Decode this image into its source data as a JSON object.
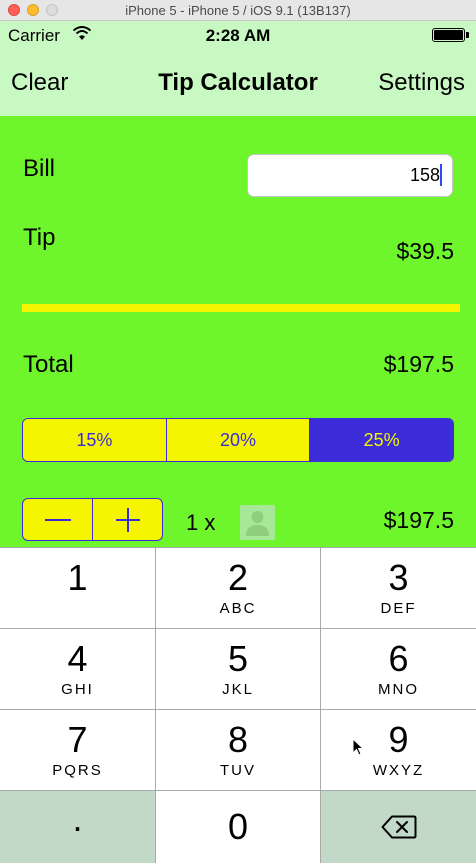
{
  "window": {
    "title": "iPhone 5 - iPhone 5 / iOS 9.1 (13B137)"
  },
  "status_bar": {
    "carrier": "Carrier",
    "time": "2:28 AM"
  },
  "nav": {
    "left": "Clear",
    "title": "Tip Calculator",
    "right": "Settings"
  },
  "bill": {
    "label": "Bill",
    "value": "158"
  },
  "tip": {
    "label": "Tip",
    "value": "$39.5"
  },
  "total": {
    "label": "Total",
    "value": "$197.5"
  },
  "tip_options": [
    {
      "label": "15%",
      "selected": false
    },
    {
      "label": "20%",
      "selected": false
    },
    {
      "label": "25%",
      "selected": true
    }
  ],
  "split": {
    "count_text": "1 x",
    "per_person": "$197.5"
  },
  "keypad": {
    "keys": [
      {
        "num": "1",
        "letters": ""
      },
      {
        "num": "2",
        "letters": "ABC"
      },
      {
        "num": "3",
        "letters": "DEF"
      },
      {
        "num": "4",
        "letters": "GHI"
      },
      {
        "num": "5",
        "letters": "JKL"
      },
      {
        "num": "6",
        "letters": "MNO"
      },
      {
        "num": "7",
        "letters": "PQRS"
      },
      {
        "num": "8",
        "letters": "TUV"
      },
      {
        "num": "9",
        "letters": "WXYZ"
      },
      {
        "num": ".",
        "letters": ""
      },
      {
        "num": "0",
        "letters": ""
      },
      {
        "num": "",
        "letters": "",
        "icon": "backspace-icon"
      }
    ]
  },
  "colors": {
    "background": "#6ef52c",
    "nav_background": "#c8f9c3",
    "accent_yellow": "#f5f500",
    "accent_blue": "#3b2bd8"
  }
}
